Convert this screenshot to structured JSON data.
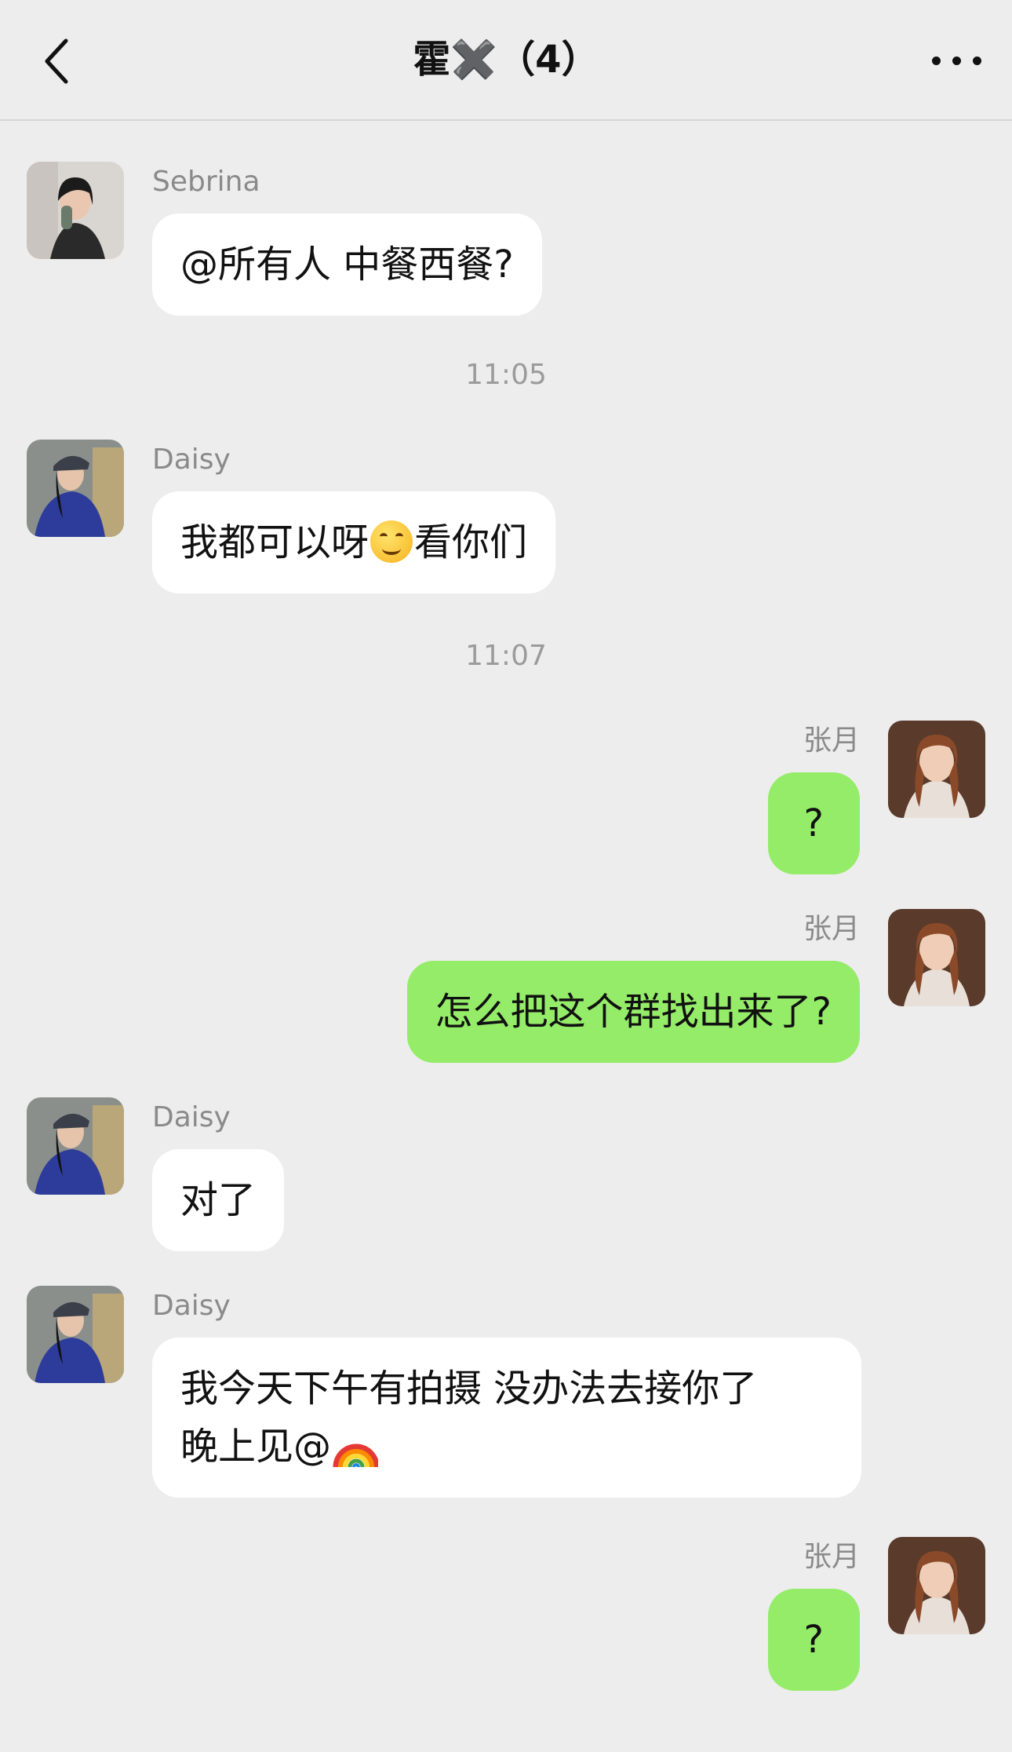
{
  "header": {
    "title": "霍✖️（4）"
  },
  "messages": [
    {
      "sender": "Sebrina",
      "text": "@所有人 中餐西餐?"
    },
    {
      "time": "11:05"
    },
    {
      "sender": "Daisy",
      "text_before": "我都可以呀",
      "emoji": "smiling-face-emoji",
      "text_after": "看你们"
    },
    {
      "time": "11:07"
    },
    {
      "sender": "张月",
      "text": "?"
    },
    {
      "sender": "张月",
      "text": "怎么把这个群找出来了?"
    },
    {
      "sender": "Daisy",
      "text": "对了"
    },
    {
      "sender": "Daisy",
      "text": "我今天下午有拍摄 没办法去接你了 晚上见@",
      "emoji": "rainbow-emoji"
    },
    {
      "sender": "张月",
      "text": "?"
    }
  ],
  "colors": {
    "background": "#ededed",
    "incoming_bubble": "#ffffff",
    "outgoing_bubble": "#95ec69"
  }
}
